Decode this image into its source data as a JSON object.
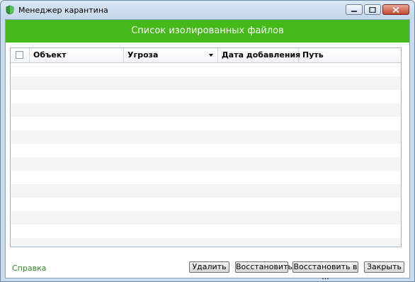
{
  "window": {
    "title": "Менеджер карантина",
    "icon": "kaspersky-shield-icon"
  },
  "banner": {
    "title": "Список изолированных файлов"
  },
  "table": {
    "columns": [
      "Объект",
      "Угроза",
      "Дата добавления",
      "Путь"
    ],
    "sorted_column": "Угроза",
    "rows": []
  },
  "footer": {
    "help_link": "Справка",
    "buttons": {
      "delete": "Удалить",
      "restore": "Восстановить",
      "restore_to": "Восстановить в ...",
      "close": "Закрыть"
    }
  },
  "colors": {
    "banner": "#45b81a",
    "help_link": "#2e8b1f"
  }
}
